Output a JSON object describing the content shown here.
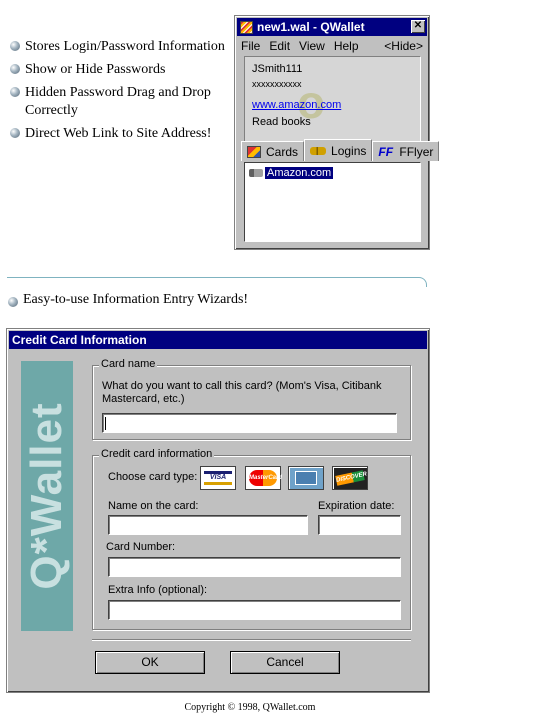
{
  "bullets": [
    {
      "text": "Stores Login/Password Information"
    },
    {
      "text": "Show or Hide Passwords"
    },
    {
      "text": "Hidden Password Drag and Drop Correctly"
    },
    {
      "text": "Direct Web Link to Site Address!"
    }
  ],
  "wallet": {
    "title": "new1.wal - QWallet",
    "close_glyph": "✕",
    "menu": [
      "File",
      "Edit",
      "View",
      "Help"
    ],
    "hide_label": "<Hide>",
    "username": "JSmith111",
    "password_mask": "xxxxxxxxxxx",
    "link": "www.amazon.com",
    "note": "Read books",
    "watermark": "o",
    "tabs": [
      "Cards",
      "Logins",
      "FFlyer"
    ],
    "ff_icon_text": "FF",
    "list_items": [
      "Amazon.com"
    ]
  },
  "wizard_bullet": "Easy-to-use Information Entry Wizards!",
  "dialog": {
    "title": "Credit Card Information",
    "banner_text": "Q*Wallet",
    "card_name_group": "Card name",
    "card_name_prompt": "What do you want to call this card? (Mom's Visa, Citibank Mastercard, etc.)",
    "card_name_value": "",
    "cc_group": "Credit card information",
    "choose_type_label": "Choose card type:",
    "card_types": [
      "VISA",
      "MasterCard",
      "AMEX",
      "DISCOVER"
    ],
    "name_label": "Name on the card:",
    "expiration_label": "Expiration date:",
    "number_label": "Card Number:",
    "extra_label": "Extra Info (optional):",
    "ok_label": "OK",
    "cancel_label": "Cancel"
  },
  "copyright": "Copyright © 1998, QWallet.com",
  "colors": {
    "titlebar": "#000080",
    "window": "#c0c0c0",
    "banner": "#6ea8a8",
    "divider": "#7fb3c0"
  }
}
